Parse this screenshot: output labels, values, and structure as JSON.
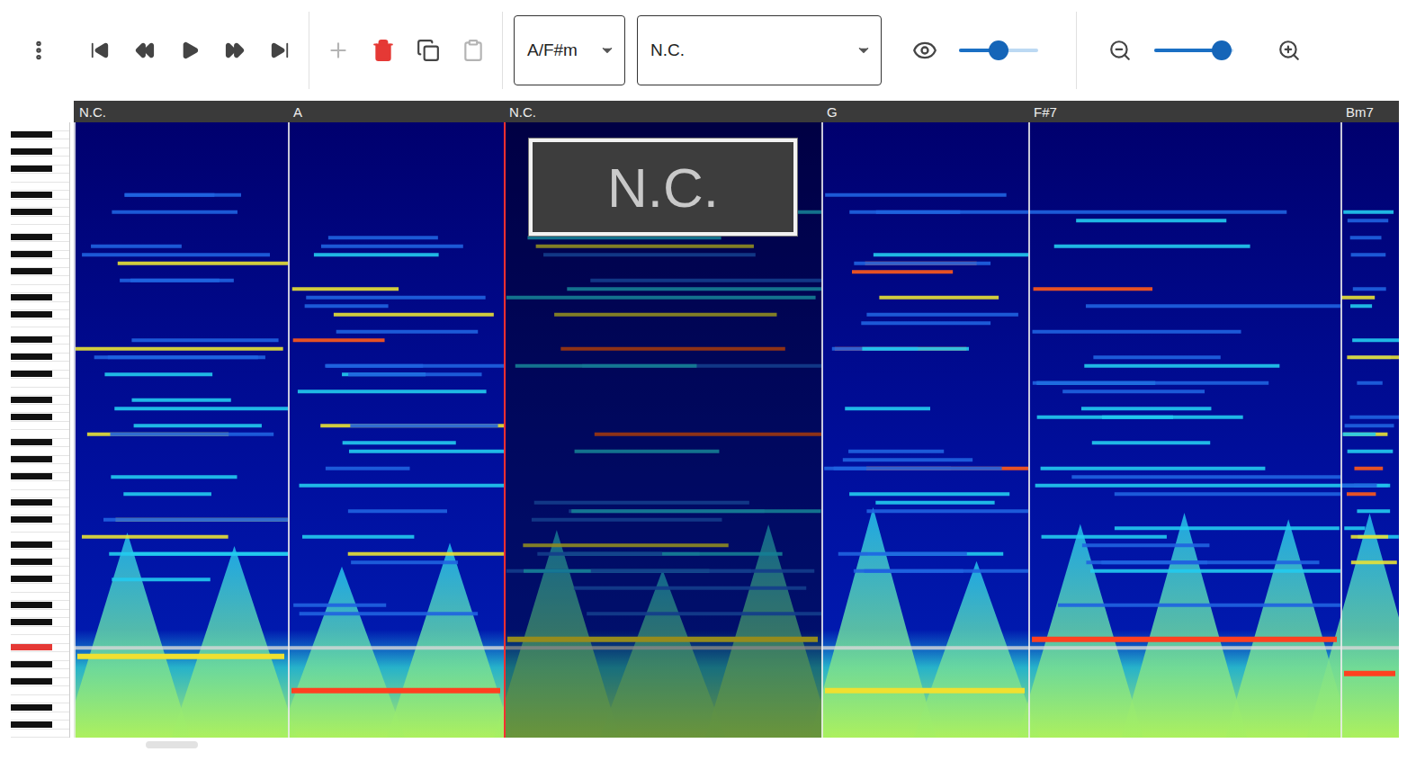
{
  "toolbar": {
    "transport_buttons": [
      {
        "disabled": false
      },
      {
        "disabled": false
      },
      {
        "disabled": false
      },
      {
        "disabled": false
      },
      {
        "disabled": false
      }
    ],
    "edit_buttons": [
      {
        "disabled": true
      },
      {
        "disabled": false
      },
      {
        "disabled": false
      },
      {
        "disabled": true
      }
    ],
    "key_select": {
      "value": "A/F#m"
    },
    "chord_select": {
      "value": "N.C."
    },
    "volume": {
      "level": 0.5
    },
    "zoom": {
      "level": 0.85
    }
  },
  "timeline": {
    "segments": [
      {
        "label": "N.C.",
        "duration": 2.38,
        "selected": false
      },
      {
        "label": "A",
        "duration": 2.4,
        "selected": false
      },
      {
        "label": "N.C.",
        "duration": 3.53,
        "selected": true
      },
      {
        "label": "G",
        "duration": 2.3,
        "selected": false
      },
      {
        "label": "F#7",
        "duration": 3.47,
        "selected": false
      },
      {
        "label": "Bm7",
        "duration": 0.65,
        "selected": false
      }
    ],
    "drag_label": "N.C."
  },
  "piano": {
    "highlighted_key": 10
  }
}
